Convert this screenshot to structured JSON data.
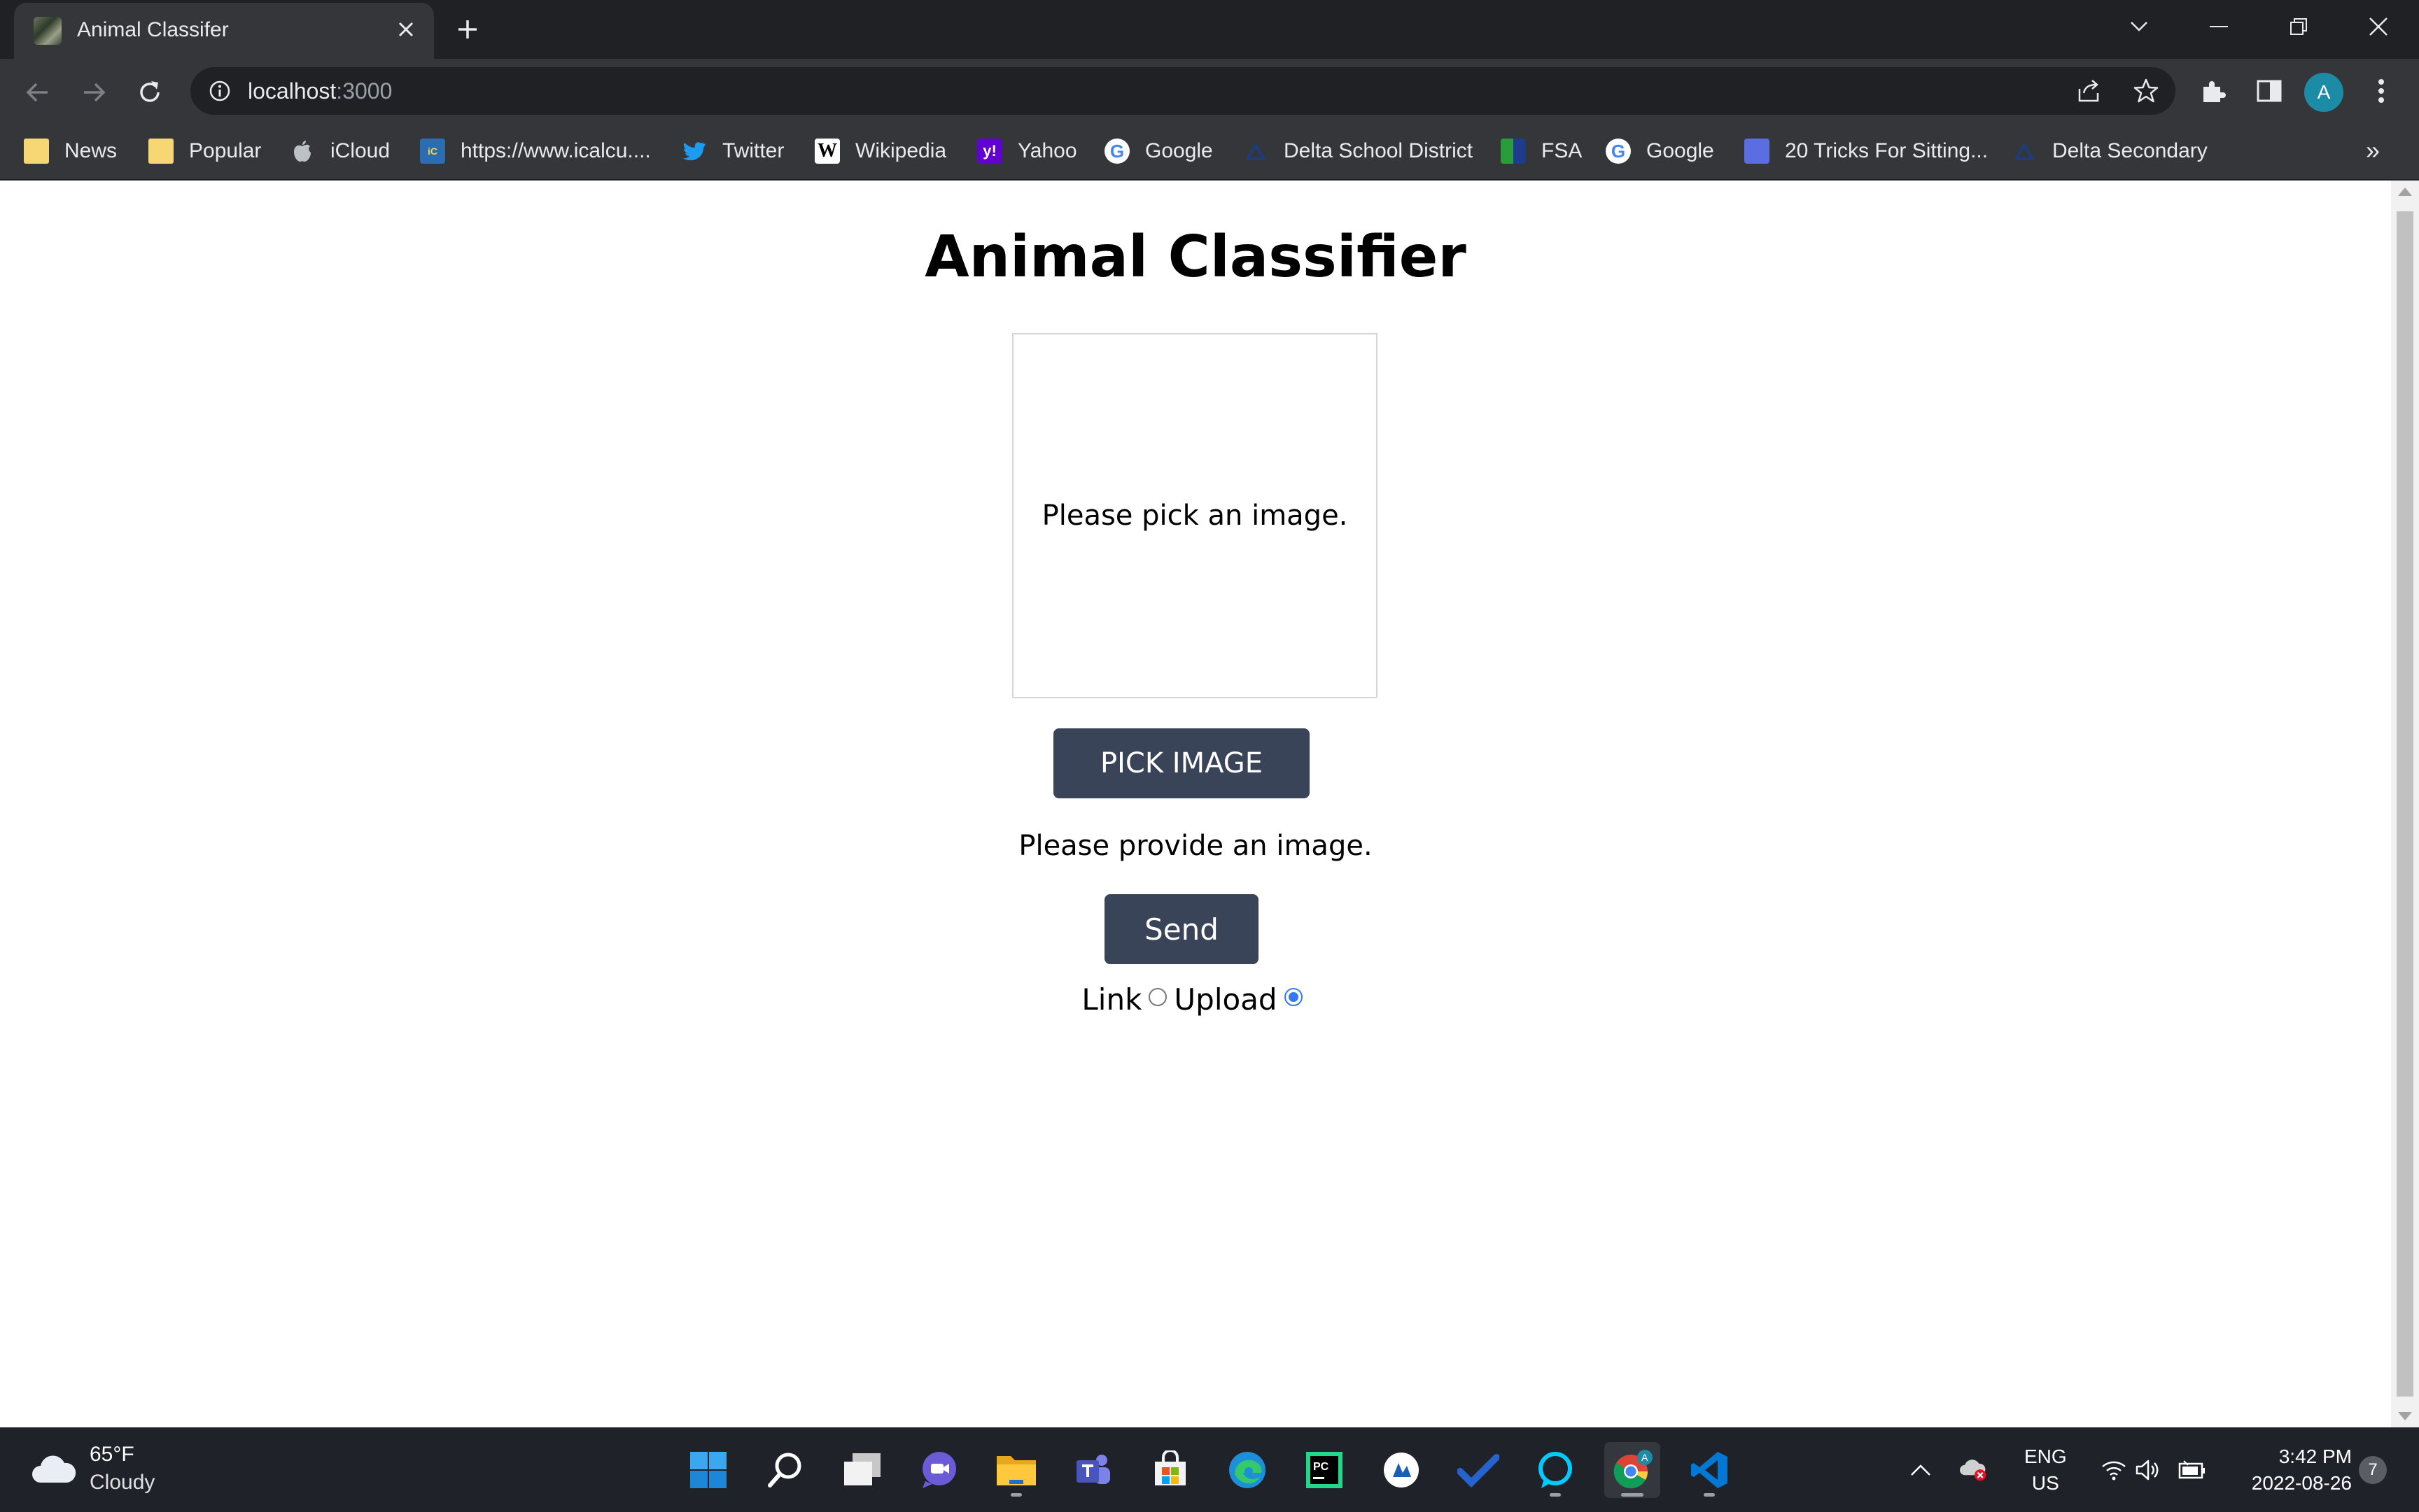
{
  "browser": {
    "tab_title": "Animal Classifer",
    "url_host": "localhost",
    "url_port": ":3000",
    "avatar_letter": "A",
    "bookmarks": [
      {
        "label": "News",
        "icon": "folder-icon"
      },
      {
        "label": "Popular",
        "icon": "folder-icon"
      },
      {
        "label": "iCloud",
        "icon": "apple-icon"
      },
      {
        "label": "https://www.icalcu....",
        "icon": "icalculator-icon"
      },
      {
        "label": "Twitter",
        "icon": "twitter-icon"
      },
      {
        "label": "Wikipedia",
        "icon": "wikipedia-icon"
      },
      {
        "label": "Yahoo",
        "icon": "yahoo-icon"
      },
      {
        "label": "Google",
        "icon": "google-icon"
      },
      {
        "label": "Delta School District",
        "icon": "delta-icon"
      },
      {
        "label": "FSA",
        "icon": "fsa-icon"
      },
      {
        "label": "Google",
        "icon": "google-icon"
      },
      {
        "label": "20 Tricks For Sitting...",
        "icon": "article-icon"
      },
      {
        "label": "Delta Secondary",
        "icon": "delta-icon"
      }
    ],
    "more_bookmarks": "»"
  },
  "app": {
    "title": "Animal Classifier",
    "image_placeholder": "Please pick an image.",
    "pick_button": "PICK IMAGE",
    "status": "Please provide an image.",
    "send_button": "Send",
    "radio_options": [
      {
        "label": "Link",
        "selected": false
      },
      {
        "label": "Upload",
        "selected": true
      }
    ],
    "button_color": "#3a4458",
    "radio_accent": "#3478f6"
  },
  "taskbar": {
    "weather_temp": "65°F",
    "weather_condition": "Cloudy",
    "language": "ENG",
    "region": "US",
    "time": "3:42 PM",
    "date": "2022-08-26",
    "notification_count": "7",
    "apps": [
      "start-icon",
      "search-icon",
      "task-view-icon",
      "chat-icon",
      "file-explorer-icon",
      "teams-icon",
      "store-icon",
      "edge-icon",
      "pycharm-icon",
      "app-icon",
      "todo-icon",
      "alexa-icon",
      "chrome-icon",
      "vscode-icon"
    ]
  }
}
